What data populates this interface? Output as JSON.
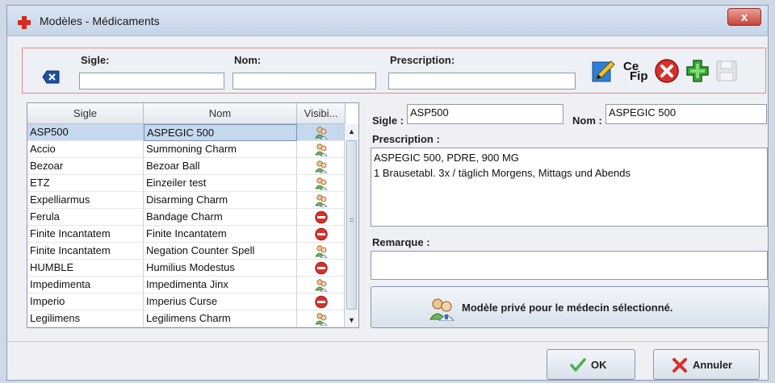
{
  "window": {
    "title": "Modèles - Médicaments",
    "close_label": "x"
  },
  "filters": {
    "sigle_label": "Sigle:",
    "nom_label": "Nom:",
    "prescription_label": "Prescription:",
    "sigle_value": "",
    "nom_value": "",
    "prescription_value": ""
  },
  "toolbar": {
    "cefip_label_1": "Ce",
    "cefip_label_2": "Fip"
  },
  "table": {
    "headers": [
      "Sigle",
      "Nom",
      "Visibi..."
    ],
    "rows": [
      {
        "sigle": "ASP500",
        "nom": "ASPEGIC 500",
        "visibility": "private-doctor-icon",
        "selected": true
      },
      {
        "sigle": "Accio",
        "nom": "Summoning Charm",
        "visibility": "private-doctor-icon"
      },
      {
        "sigle": "Bezoar",
        "nom": "Bezoar Ball",
        "visibility": "private-doctor-icon"
      },
      {
        "sigle": "ETZ",
        "nom": "Einzeiler test",
        "visibility": "private-doctor-icon"
      },
      {
        "sigle": "Expelliarmus",
        "nom": "Disarming Charm",
        "visibility": "private-doctor-icon"
      },
      {
        "sigle": "Ferula",
        "nom": "Bandage Charm",
        "visibility": "no-entry-icon"
      },
      {
        "sigle": "Finite Incantatem",
        "nom": "Finite Incantatem",
        "visibility": "no-entry-icon"
      },
      {
        "sigle": "Finite Incantatem",
        "nom": "Negation Counter Spell",
        "visibility": "private-doctor-icon"
      },
      {
        "sigle": "HUMBLE",
        "nom": "Humilius Modestus",
        "visibility": "no-entry-icon"
      },
      {
        "sigle": "Impedimenta",
        "nom": "Impedimenta Jinx",
        "visibility": "private-doctor-icon"
      },
      {
        "sigle": "Imperio",
        "nom": "Imperius Curse",
        "visibility": "no-entry-icon"
      },
      {
        "sigle": "Legilimens",
        "nom": "Legilimens Charm",
        "visibility": "private-doctor-icon"
      }
    ]
  },
  "detail": {
    "sigle_label": "Sigle :",
    "sigle_value": "ASP500",
    "nom_label": "Nom :",
    "nom_value": "ASPEGIC 500",
    "prescription_label": "Prescription :",
    "prescription_lines": [
      "ASPEGIC 500, PDRE, 900 MG",
      "1 Brausetabl. 3x / täglich Morgens, Mittags und Abends"
    ],
    "remarque_label": "Remarque :",
    "remarque_value": "",
    "private_button_label": "Modèle privé pour le médecin sélectionné."
  },
  "actions": {
    "ok_label": "OK",
    "cancel_label": "Annuler"
  },
  "colors": {
    "accent_red": "#d42a1f",
    "accent_green": "#3aa63a",
    "selection": "#c6d8ee"
  }
}
